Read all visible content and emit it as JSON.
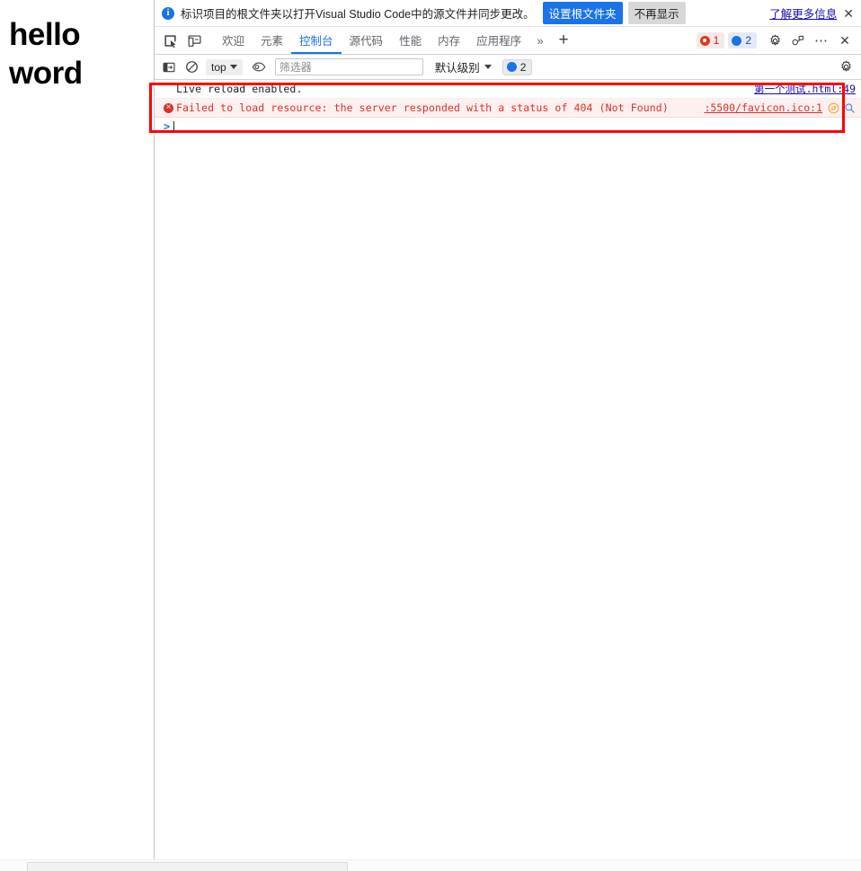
{
  "page": {
    "heading_line1": "hello",
    "heading_line2": "word"
  },
  "infobar": {
    "icon": "info-icon",
    "message": "标识项目的根文件夹以打开Visual Studio Code中的源文件并同步更改。",
    "primary_button": "设置根文件夹",
    "secondary_button": "不再显示",
    "learn_more": "了解更多信息",
    "close": "✕"
  },
  "tabbar": {
    "inspect_icon": "inspect-element-icon",
    "device_icon": "device-toolbar-icon",
    "tabs": [
      {
        "label": "欢迎",
        "active": false
      },
      {
        "label": "元素",
        "active": false
      },
      {
        "label": "控制台",
        "active": true
      },
      {
        "label": "源代码",
        "active": false
      },
      {
        "label": "性能",
        "active": false
      },
      {
        "label": "内存",
        "active": false
      },
      {
        "label": "应用程序",
        "active": false
      }
    ],
    "more_tabs": "»",
    "add_tab": "+",
    "error_count": "1",
    "info_count": "2",
    "settings_icon": "gear-icon",
    "customize_icon": "devices-icon",
    "more_options": "⋯",
    "close": "✕"
  },
  "console_toolbar": {
    "sidebar_icon": "show-console-sidebar-icon",
    "clear_icon": "clear-console-icon",
    "context": "top",
    "eye_icon": "live-expression-icon",
    "filter_placeholder": "筛选器",
    "filter_value": "",
    "levels_label": "默认级别",
    "message_count": "2",
    "settings_icon": "gear-icon"
  },
  "console": {
    "messages": [
      {
        "type": "log",
        "text": "Live reload enabled.",
        "source": "第一个测试.html:49",
        "source_color": "#1a0dab",
        "has_error_icon": false,
        "has_network_icons": false
      },
      {
        "type": "error",
        "text": "Failed to load resource: the server responded with a status of 404 (Not Found)",
        "source": ":5500/favicon.ico:1",
        "source_color": "#d93025",
        "has_error_icon": true,
        "has_network_icons": true,
        "network_icon": "network-request-icon",
        "search_icon": "search-icon"
      }
    ],
    "prompt": ">"
  },
  "colors": {
    "accent": "#1a73e8",
    "error": "#d93025",
    "error_bg": "#fff0f0",
    "link": "#1a0dab",
    "annotation": "#ff0000"
  },
  "scrollbar": {
    "orientation": "horizontal"
  }
}
